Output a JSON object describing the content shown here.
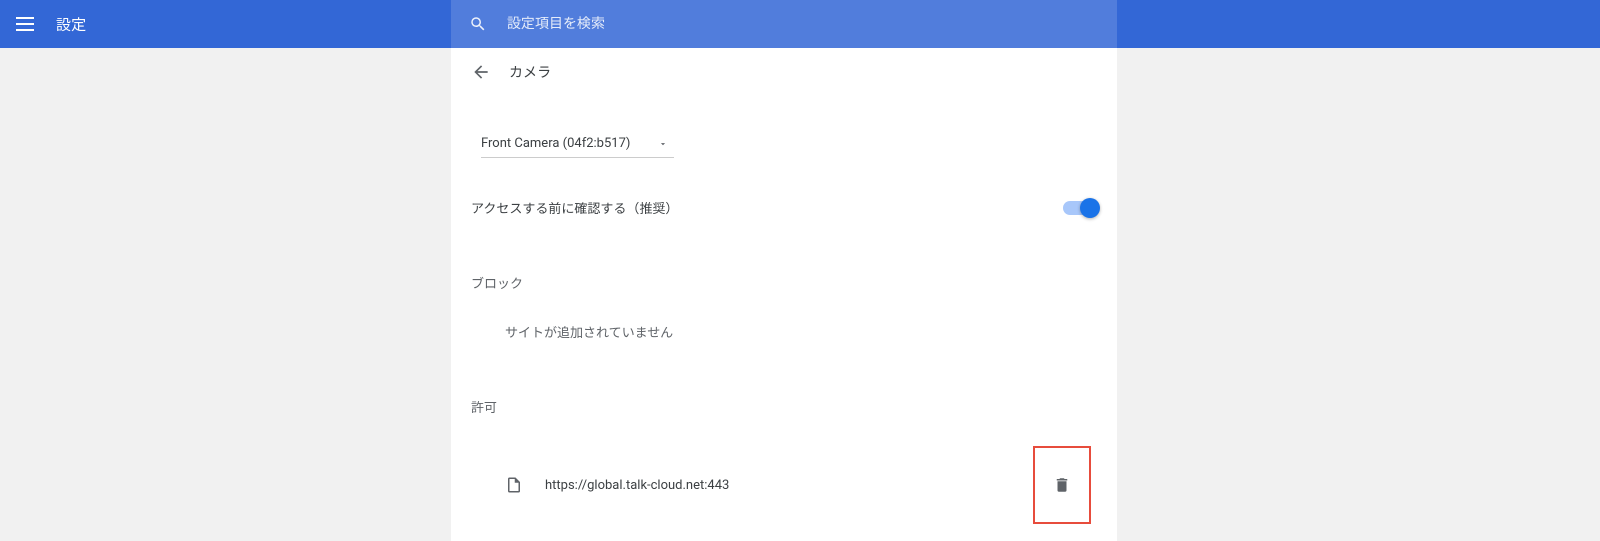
{
  "header": {
    "app_title": "設定",
    "search_placeholder": "設定項目を検索"
  },
  "page": {
    "title": "カメラ",
    "camera_select": "Front Camera (04f2:b517)",
    "ask_label": "アクセスする前に確認する（推奨）",
    "block_section": "ブロック",
    "no_sites_text": "サイトが追加されていません",
    "allow_section": "許可",
    "allowed_site": "https://global.talk-cloud.net:443"
  }
}
